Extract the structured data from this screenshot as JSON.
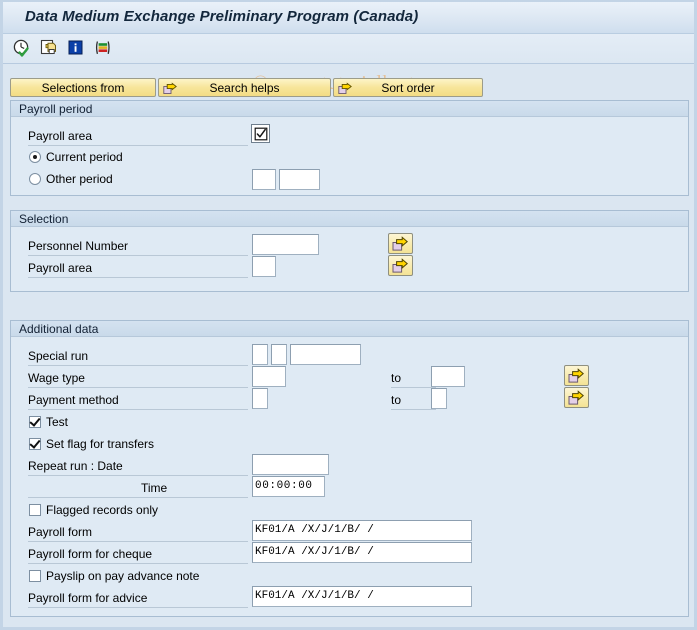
{
  "window": {
    "title": "Data Medium Exchange Preliminary Program (Canada)",
    "watermark": "© www.tutorialkart.com"
  },
  "toolbar": {
    "icons": [
      {
        "name": "execute-clock-icon",
        "title": "Execute"
      },
      {
        "name": "copy-variant-icon",
        "title": "Get Variant"
      },
      {
        "name": "info-icon",
        "title": "Information"
      },
      {
        "name": "multiple-selection-icon",
        "title": "Multiple selection"
      }
    ]
  },
  "buttons": {
    "selections_from": "Selections from",
    "search_helps": "Search helps",
    "sort_order": "Sort order"
  },
  "sections": {
    "payroll_period": {
      "title": "Payroll period",
      "payroll_area_label": "Payroll area",
      "payroll_area_value": "",
      "current_period_label": "Current period",
      "other_period_label": "Other period",
      "other_period_value_1": "",
      "other_period_value_2": "",
      "selected_radio": "current_period"
    },
    "selection": {
      "title": "Selection",
      "personnel_number_label": "Personnel Number",
      "personnel_number_value": "",
      "payroll_area_label": "Payroll area",
      "payroll_area_value": ""
    },
    "additional_data": {
      "title": "Additional data",
      "special_run_label": "Special run",
      "special_run_value_1": "",
      "special_run_value_2": "",
      "special_run_value_3": "",
      "wage_type_label": "Wage type",
      "wage_type_from": "",
      "wage_type_to_label": "to",
      "wage_type_to": "",
      "payment_method_label": "Payment method",
      "payment_method_from": "",
      "payment_method_to_label": "to",
      "payment_method_to": "",
      "test_label": "Test",
      "test_checked": true,
      "set_flag_label": "Set flag for transfers",
      "set_flag_checked": true,
      "repeat_run_label": "Repeat run    : Date",
      "repeat_run_date_value": "",
      "time_label": "Time",
      "time_value": "00:00:00",
      "flagged_records_label": "Flagged records only",
      "flagged_records_checked": false,
      "payroll_form_label": "Payroll form",
      "payroll_form_value": "KF01/A /X/J/1/B/  /",
      "payroll_form_cheque_label": "Payroll form for cheque",
      "payroll_form_cheque_value": "KF01/A /X/J/1/B/  /",
      "payslip_advance_label": "Payslip on pay advance note",
      "payslip_advance_checked": false,
      "payroll_form_advice_label": "Payroll form for advice",
      "payroll_form_advice_value": "KF01/A /X/J/1/B/  /"
    }
  },
  "colors": {
    "window_bg": "#dbe6f1",
    "group_bg": "#dfeaf4",
    "button_yellow": "#f7e59a",
    "watermark": "#e6bb8c",
    "title_text": "#13273c"
  }
}
